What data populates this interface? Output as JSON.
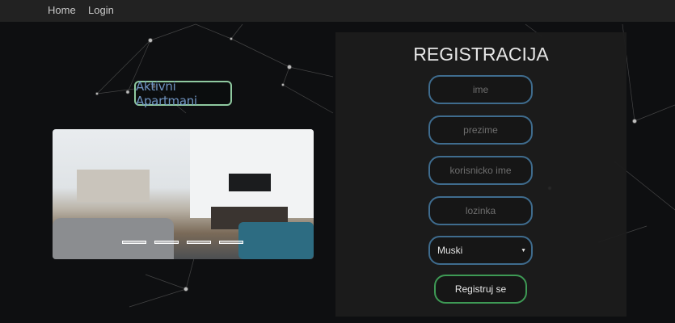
{
  "nav": {
    "items": [
      {
        "label": "Home"
      },
      {
        "label": "Login"
      }
    ]
  },
  "hero": {
    "label": "Aktivni Apartmani",
    "carousel_slides": 4,
    "active_slide": 1
  },
  "form": {
    "title": "REGISTRACIJA",
    "fields": [
      {
        "name": "ime",
        "placeholder": "ime",
        "value": ""
      },
      {
        "name": "prezime",
        "placeholder": "prezime",
        "value": ""
      },
      {
        "name": "korisnicko-ime",
        "placeholder": "korisnicko ime",
        "value": ""
      },
      {
        "name": "lozinka",
        "placeholder": "lozinka",
        "value": ""
      }
    ],
    "gender": {
      "selected": "Muski"
    },
    "submit_label": "Registruj se"
  },
  "colors": {
    "input_border": "#3f6c8e",
    "button_border": "#3e9a55",
    "label_border": "#8fc9a0",
    "label_text": "#6f93c0"
  }
}
